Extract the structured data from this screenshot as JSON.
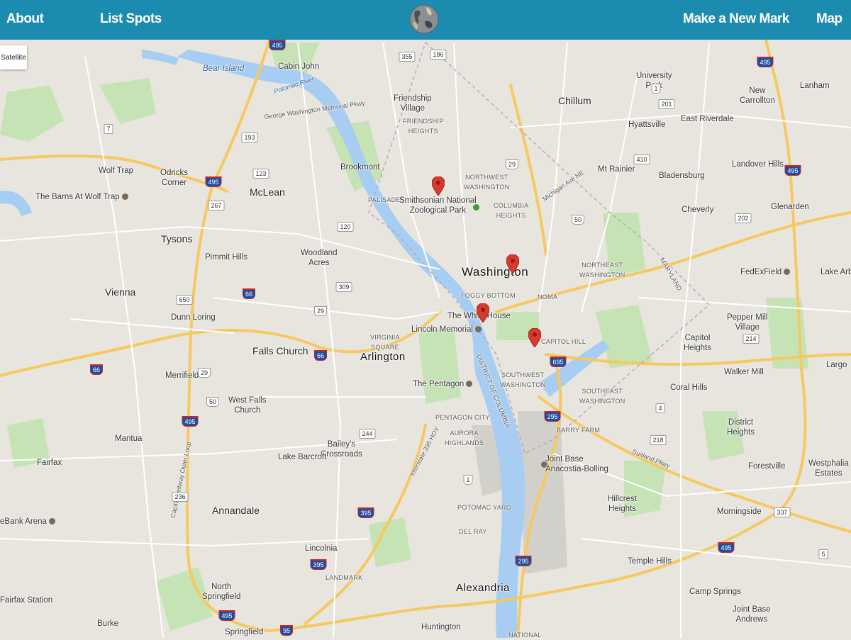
{
  "nav": {
    "about": "About",
    "list_spots": "List Spots",
    "new_mark": "Make a New Mark",
    "map": "Map"
  },
  "map": {
    "satellite_button": "Satellite",
    "pin_color": "#d93a30",
    "markers": [
      {
        "name": "marker-zoo"
      },
      {
        "name": "marker-downtown"
      },
      {
        "name": "marker-white-house"
      },
      {
        "name": "marker-capitol-hill"
      }
    ],
    "labels": {
      "bear_island": "Bear Island",
      "cabin_john": "Cabin John",
      "potomac_river": "Potomac River",
      "friendship_village": "Friendship\nVillage",
      "friendship_heights": "FRIENDSHIP\nHEIGHTS",
      "chillum": "Chillum",
      "university_park": "University\nPark",
      "new_carrollton": "New\nCarrollton",
      "lanham": "Lanham",
      "hyattsville": "Hyattsville",
      "east_riverdale": "East Riverdale",
      "wolf_trap": "Wolf Trap",
      "odricks_corner": "Odricks\nCorner",
      "barns_wolf_trap": "The Barns At Wolf Trap",
      "mclean": "McLean",
      "brookmont": "Brookmont",
      "palisades": "PALISADES",
      "smithsonian_zoo": "Smithsonian National\nZoological Park",
      "northwest_washington": "NORTHWEST\nWASHINGTON",
      "columbia_heights": "COLUMBIA\nHEIGHTS",
      "mt_rainier": "Mt Rainier",
      "bladensburg": "Bladensburg",
      "landover_hills": "Landover Hills",
      "cheverly": "Cheverly",
      "glenarden": "Glenarden",
      "tysons": "Tysons",
      "pimmit_hills": "Pimmit Hills",
      "woodland_acres": "Woodland\nAcres",
      "washington": "Washington",
      "foggy_bottom": "FOGGY BOTTOM",
      "noma": "NOMA",
      "northeast_washington": "NORTHEAST\nWASHINGTON",
      "fedexfield": "FedExField",
      "lake_arbor": "Lake Arbo",
      "vienna": "Vienna",
      "dunn_loring": "Dunn Loring",
      "white_house": "The White House",
      "lincoln_memorial": "Lincoln Memorial",
      "virginia_square": "VIRGINIA\nSQUARE",
      "capitol_hill": "CAPITOL HILL",
      "pepper_mill_village": "Pepper Mill\nVillage",
      "capitol_heights": "Capitol\nHeights",
      "falls_church": "Falls Church",
      "arlington": "Arlington",
      "merrifield": "Merrifield",
      "the_pentagon": "The Pentagon",
      "southwest_washington": "SOUTHWEST\nWASHINGTON",
      "southeast_washington": "SOUTHEAST\nWASHINGTON",
      "walker_mill": "Walker Mill",
      "largo": "Largo",
      "coral_hills": "Coral Hills",
      "west_falls_church": "West Falls\nChurch",
      "pentagon_city": "PENTAGON CITY",
      "aurora_highlands": "AURORA\nHIGHLANDS",
      "barry_farm": "BARRY FARM",
      "district_heights": "District\nHeights",
      "mantua": "Mantua",
      "baileys_crossroads": "Bailey's\nCrossroads",
      "lake_barcroft": "Lake Barcroft",
      "joint_base_anacostia": "Joint Base\nAnacostia-Bolling",
      "forestville": "Forestville",
      "westphalia_estates": "Westphalia\nEstates",
      "fairfax": "Fairfax",
      "potomac_yard": "POTOMAC YARD",
      "hillcrest_heights": "Hillcrest\nHeights",
      "annandale": "Annandale",
      "del_ray": "DEL RAY",
      "morningside": "Morningside",
      "bank_arena": "eBank Arena",
      "lincolnia": "Lincolnia",
      "temple_hills": "Temple Hills",
      "north_springfield": "North\nSpringfield",
      "landmark": "LANDMARK",
      "alexandria": "Alexandria",
      "camp_springs": "Camp Springs",
      "fairfax_station": "Fairfax Station",
      "burke": "Burke",
      "joint_base_andrews": "Joint Base\nAndrews",
      "huntington": "Huntington",
      "springfield": "Springfield",
      "national": "NATIONAL",
      "gw_parkway": "George Washington Memorial Pkwy",
      "capital_beltway": "Capital Beltway Outer Loop",
      "interstate_395": "Interstate 395 HOV",
      "suitland_pkwy": "Suitland Pkwy",
      "michigan_ave": "Michigan Ave NE",
      "district_of_columbia": "DISTRICT OF COLUMBIA",
      "maryland": "MARYLAND"
    },
    "shields": {
      "i495_top": "495",
      "i495_ne": "495",
      "i495_wolf": "495",
      "i495_springfield": "495",
      "i495_alex": "495",
      "i495_se": "495",
      "i495_bottom": "495",
      "i66_a": "66",
      "i66_b": "66",
      "i66_c": "66",
      "i395_a": "395",
      "i395_b": "395",
      "i295_a": "295",
      "i295_b": "295",
      "i695": "695",
      "i95": "95",
      "r50_a": "50",
      "r50_b": "50",
      "r29_a": "29",
      "r29_b": "29",
      "r29_c": "29",
      "r1_a": "1",
      "r1_b": "1",
      "r7": "7",
      "r123": "123",
      "r267": "267",
      "r236": "236",
      "r193": "193",
      "r309": "309",
      "r120": "120",
      "r244": "244",
      "r650": "650",
      "r355": "355",
      "r186": "186",
      "r410": "410",
      "r201": "201",
      "r202": "202",
      "r214": "214",
      "r218": "218",
      "r4": "4",
      "r5": "5",
      "r337": "337"
    }
  }
}
